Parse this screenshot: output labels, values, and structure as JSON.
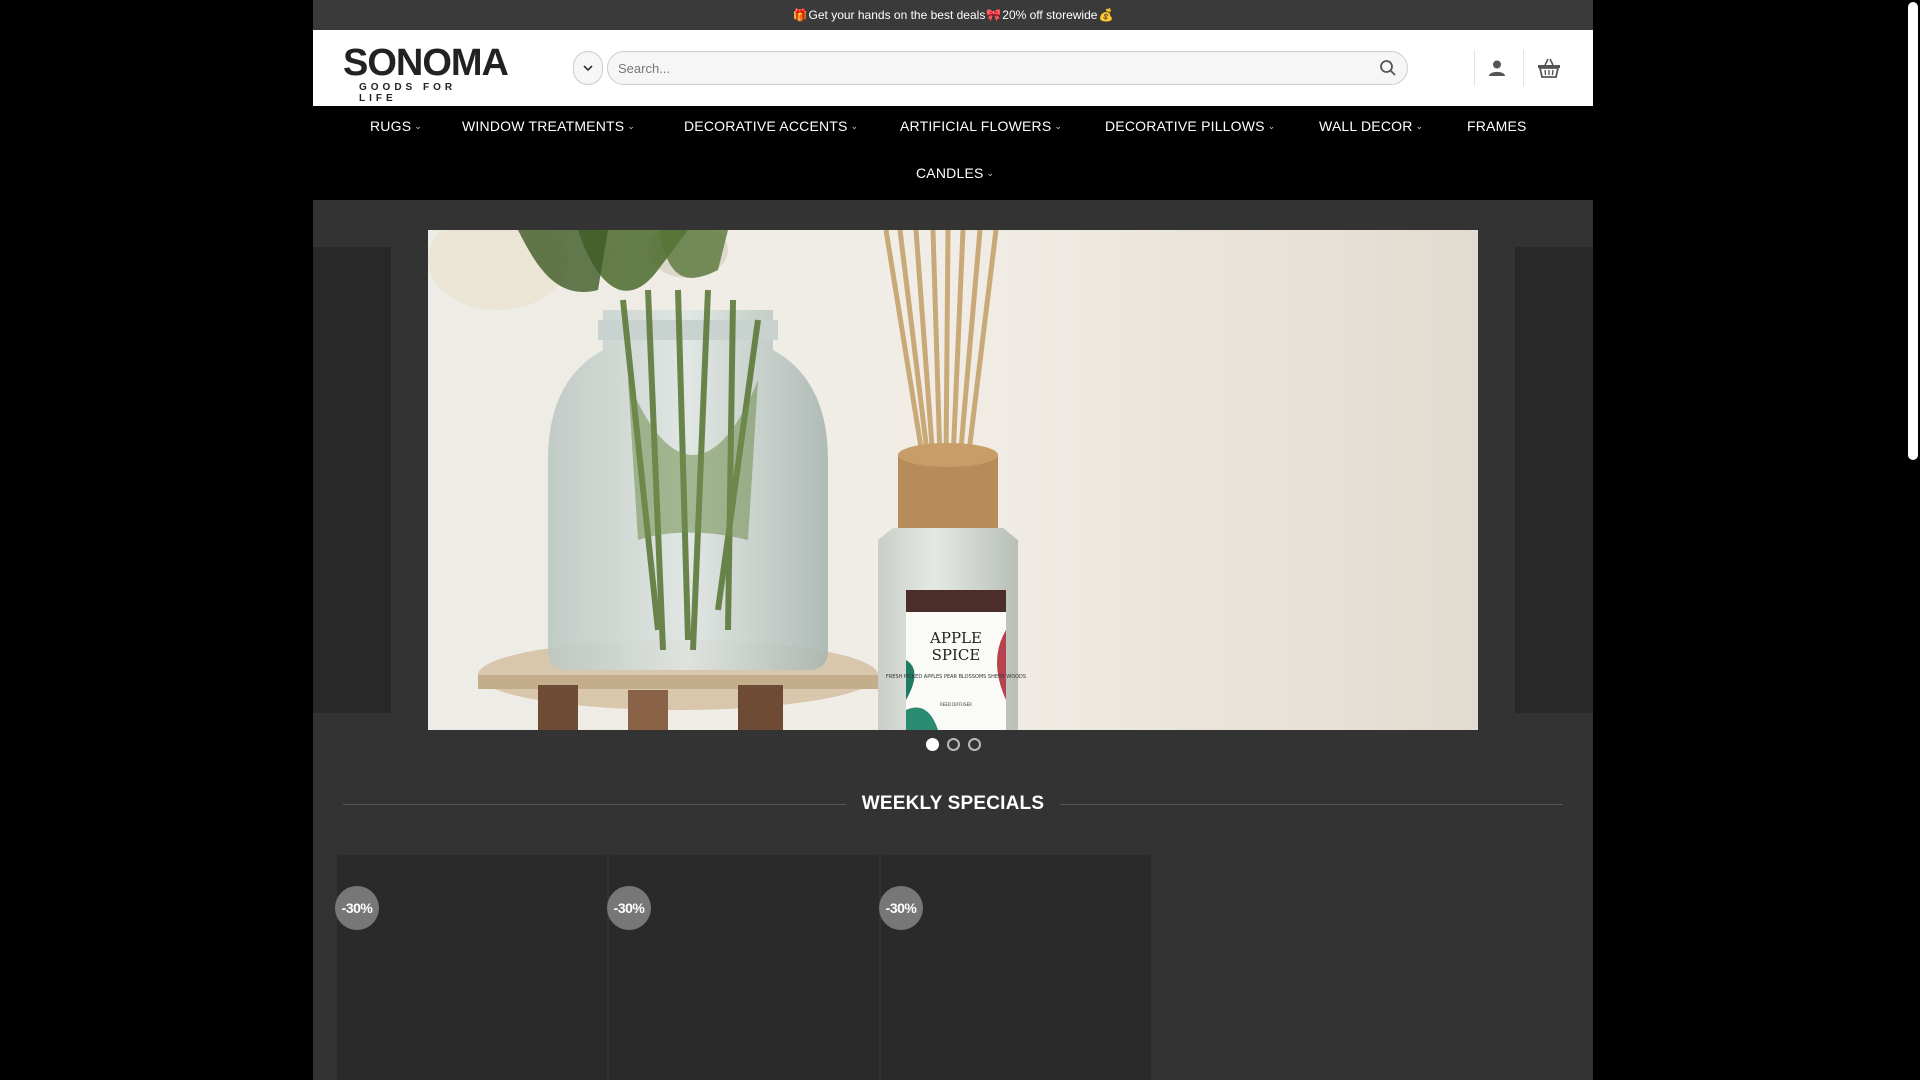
{
  "promo": {
    "icon_left": "gift-icon",
    "text_before": "Get your hands on the best deals",
    "icon_mid": "ribbon-icon",
    "text_after": "20% off storewide",
    "icon_right": "money-bag-icon"
  },
  "header": {
    "logo_main": "SONOMA",
    "logo_sub": "GOODS FOR LIFE",
    "search_placeholder": "Search..."
  },
  "nav": {
    "items": [
      {
        "label": "RUGS",
        "dropdown": true
      },
      {
        "label": "WINDOW TREATMENTS",
        "dropdown": true
      },
      {
        "label": "DECORATIVE ACCENTS",
        "dropdown": true
      },
      {
        "label": "ARTIFICIAL FLOWERS",
        "dropdown": true
      },
      {
        "label": "DECORATIVE PILLOWS",
        "dropdown": true
      },
      {
        "label": "WALL DECOR",
        "dropdown": true
      },
      {
        "label": "FRAMES",
        "dropdown": false
      },
      {
        "label": "CANDLES",
        "dropdown": true
      }
    ]
  },
  "hero": {
    "label_line1": "APPLE",
    "label_line2": "SPICE",
    "label_desc": "FRESH PICKED APPLES PEAR BLOSSOMS SHEER WOODS",
    "label_brand": "REED DIFFUSER",
    "slide_count": 3,
    "active_slide": 1
  },
  "weekly": {
    "title": "WEEKLY SPECIALS",
    "badges": [
      "-30%",
      "-30%",
      "-30%"
    ]
  },
  "colors": {
    "page_bg": "#333333",
    "nav_bg": "#000000",
    "badge_bg": "#777777"
  }
}
